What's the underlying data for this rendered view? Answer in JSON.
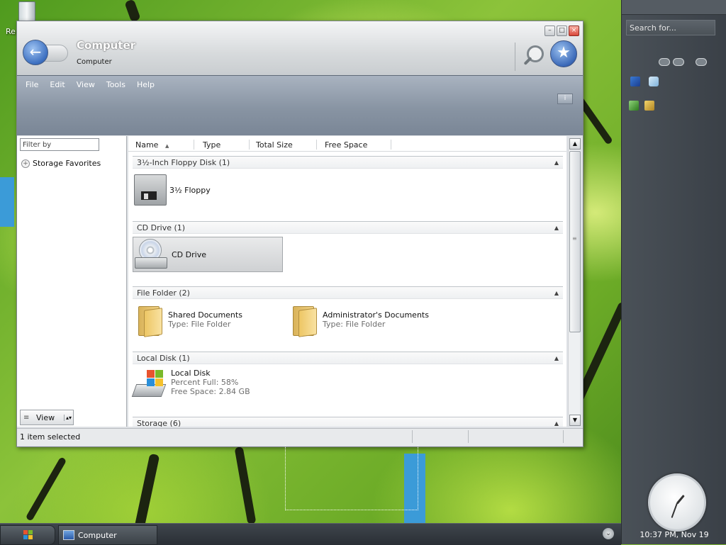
{
  "desktop": {
    "recycle_label": "Re"
  },
  "window": {
    "title": "Computer",
    "subtitle": "Computer",
    "controls": {
      "minimize": "–",
      "maximize": "□",
      "close": "×"
    },
    "back_glyph": "←",
    "favorite_glyph": "★",
    "info_glyph": "i"
  },
  "menu": [
    "File",
    "Edit",
    "View",
    "Tools",
    "Help"
  ],
  "left_pane": {
    "filter_placeholder": "Filter by",
    "favorites_label": "Storage Favorites",
    "plus_glyph": "+",
    "view_label": "View",
    "view_icon": "≡",
    "view_dropdown": "▴▾"
  },
  "columns": [
    {
      "label": "Name",
      "sort": "▲"
    },
    {
      "label": "Type"
    },
    {
      "label": "Total Size"
    },
    {
      "label": "Free Space"
    }
  ],
  "groups": [
    {
      "label": "3½-Inch Floppy Disk (1)",
      "caret": "▲"
    },
    {
      "label": "CD Drive (1)",
      "caret": "▲"
    },
    {
      "label": "File Folder (2)",
      "caret": "▲"
    },
    {
      "label": "Local Disk (1)",
      "caret": "▲"
    },
    {
      "label": "Storage (6)",
      "caret": "▲"
    }
  ],
  "items": {
    "floppy": {
      "name": "3½ Floppy",
      "icon": "floppy-disk-icon"
    },
    "cd": {
      "name": "CD Drive",
      "icon": "cd-drive-icon",
      "selected": true
    },
    "shared_docs": {
      "name": "Shared Documents",
      "type": "Type: File Folder",
      "icon": "folder-icon"
    },
    "admin_docs": {
      "name": "Administrator's Documents",
      "type": "Type: File Folder",
      "icon": "folder-icon"
    },
    "local_disk": {
      "name": "Local Disk",
      "percent": "Percent Full: 58%",
      "free": "Free Space: 2.84 GB",
      "icon": "hard-disk-icon"
    }
  },
  "scrollbar": {
    "up": "▲",
    "down": "▼",
    "grip": "≡"
  },
  "status": {
    "text": "1 item selected"
  },
  "sidebar": {
    "search_placeholder": "Search for...",
    "clock_text": "10:37 PM, Nov 19"
  },
  "taskbar": {
    "task_label": "Computer",
    "tray_glyph": "⌄"
  },
  "colors": {
    "accent_blue": "#3c6fc0",
    "sidebar_bg": "#3a4047",
    "menubar_bg": "#8894a3",
    "selection": "#cfd1d3"
  }
}
